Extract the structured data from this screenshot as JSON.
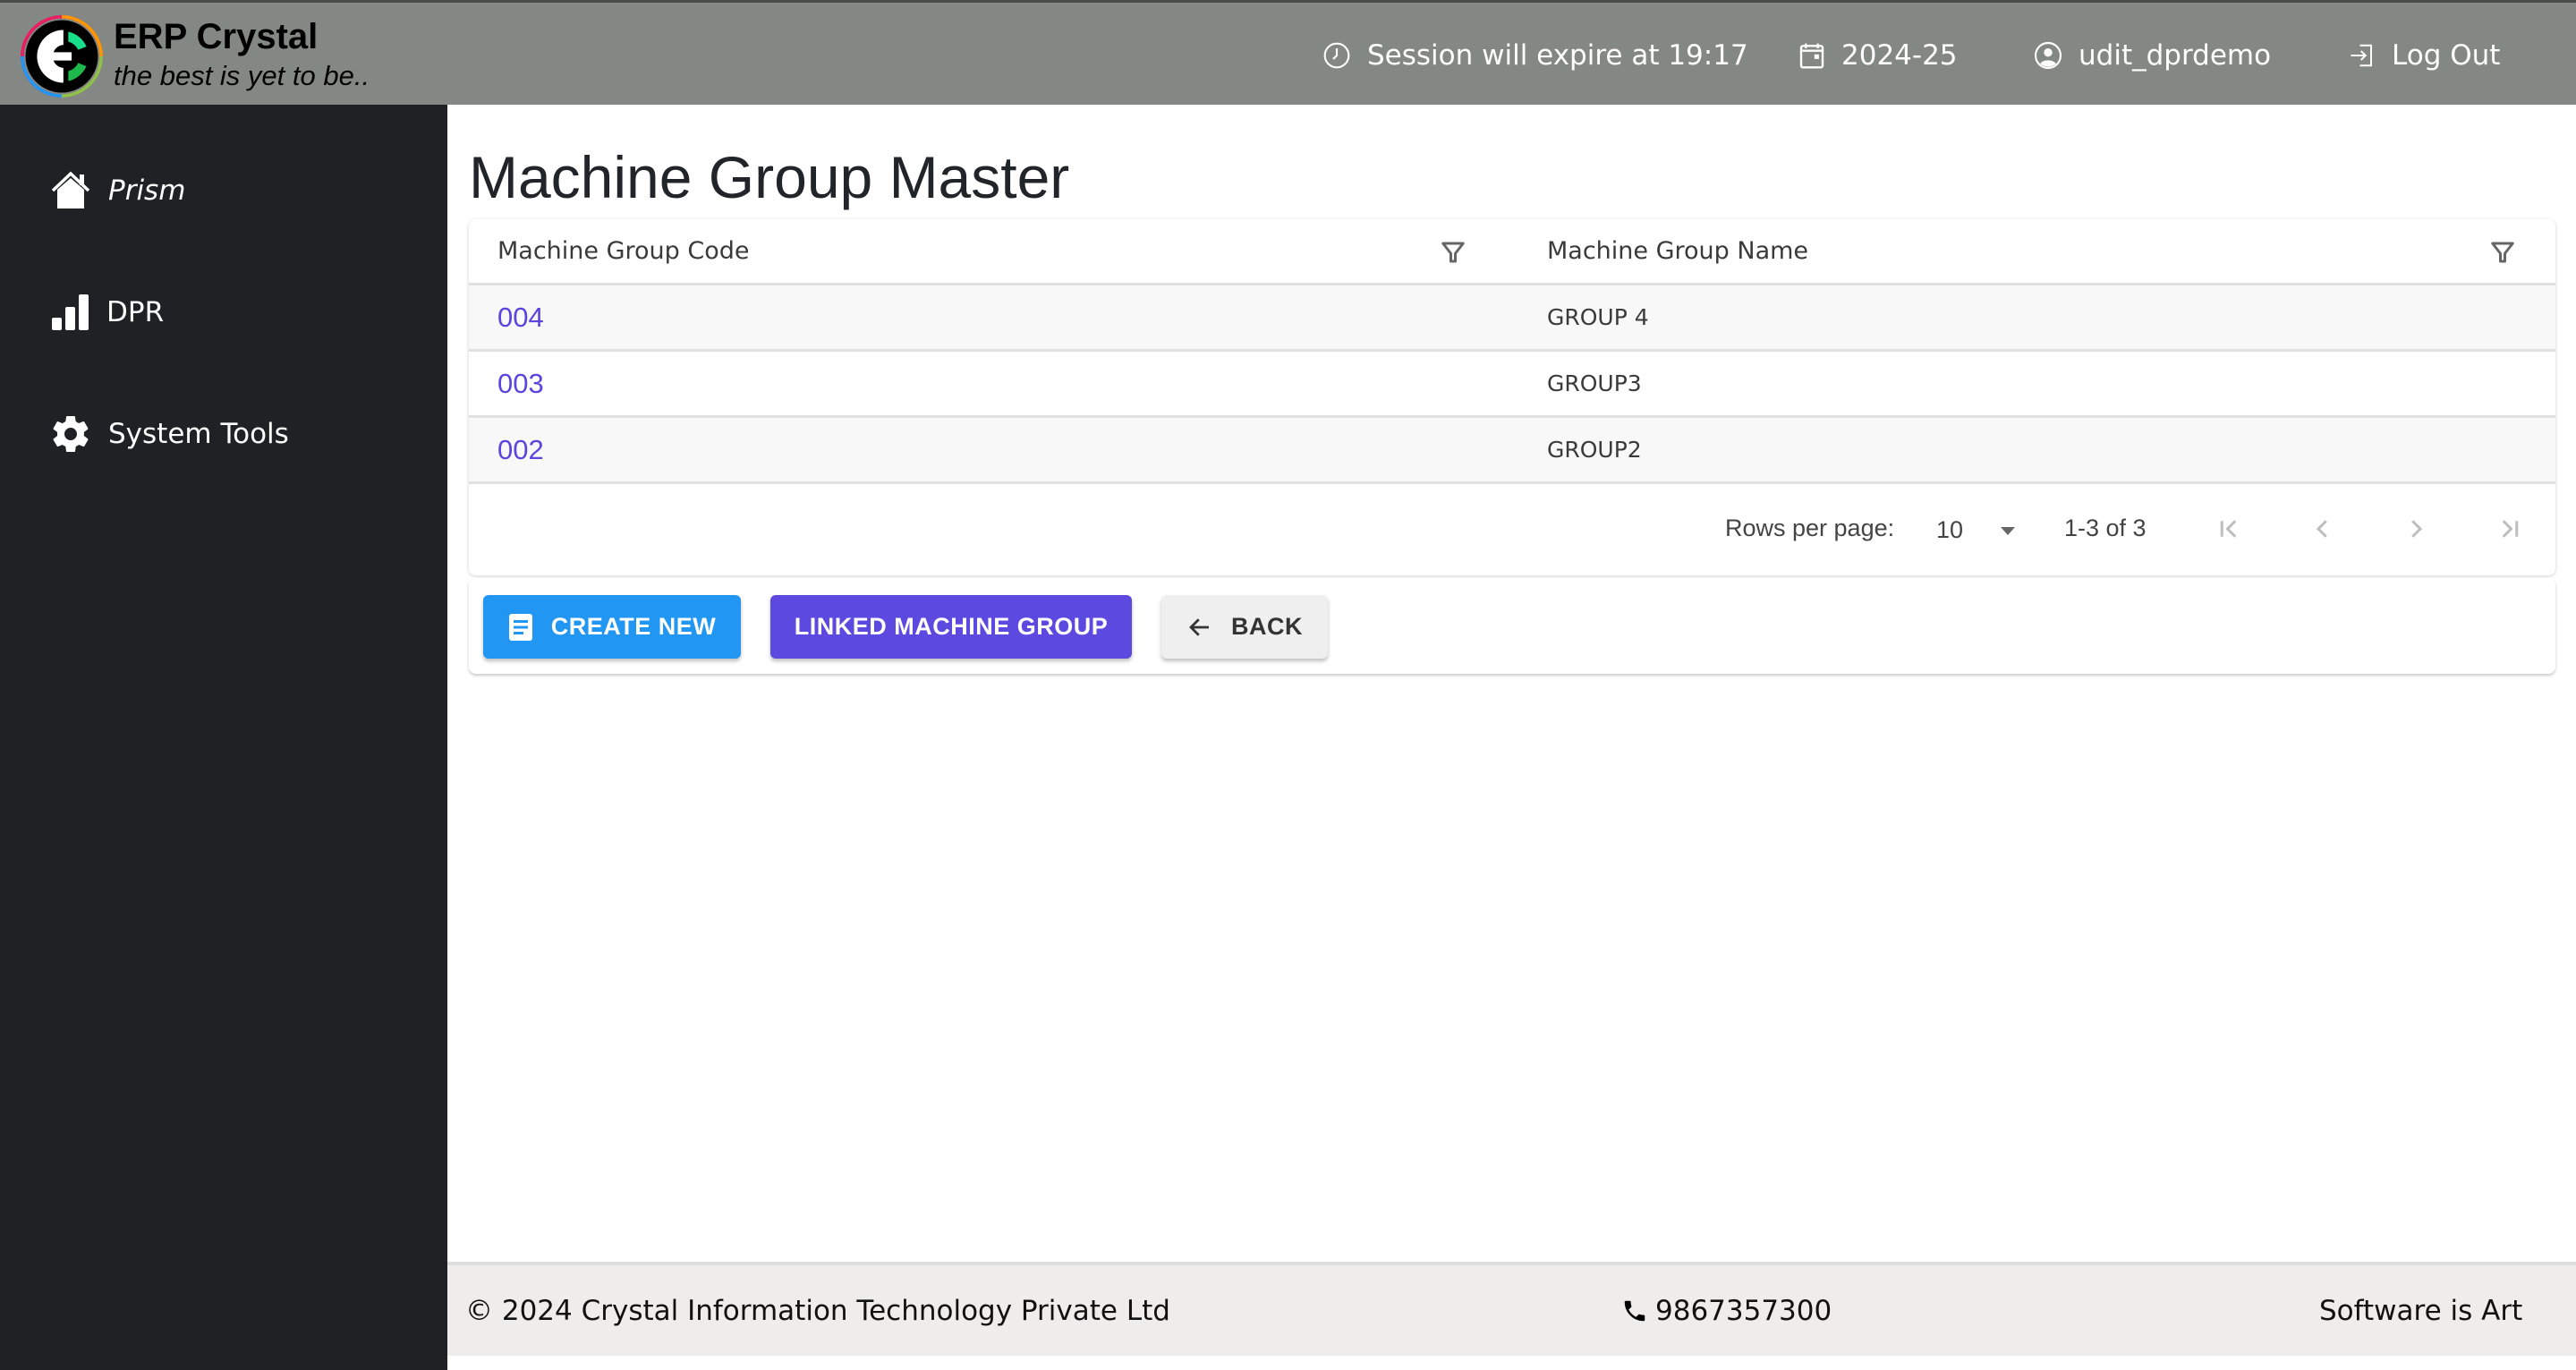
{
  "header": {
    "brand_title": "ERP Crystal",
    "brand_tagline": "the best is yet to be..",
    "session_text": "Session will expire at 19:17",
    "session_icon": "clock-icon",
    "financial_year": "2024-25",
    "financial_year_icon": "calendar-icon",
    "username": "udit_dprdemo",
    "user_icon": "user-circle-icon",
    "logout_label": "Log Out",
    "logout_icon": "logout-icon"
  },
  "sidebar": {
    "items": [
      {
        "label": "Prism",
        "icon": "home-icon"
      },
      {
        "label": "DPR",
        "icon": "bar-chart-icon"
      },
      {
        "label": "System Tools",
        "icon": "gear-icon"
      }
    ]
  },
  "page": {
    "title": "Machine Group Master"
  },
  "table": {
    "columns": [
      "Machine Group Code",
      "Machine Group Name"
    ],
    "rows": [
      {
        "code": "004",
        "name": "GROUP 4"
      },
      {
        "code": "003",
        "name": "GROUP3"
      },
      {
        "code": "002",
        "name": "GROUP2"
      }
    ],
    "pagination": {
      "rows_per_page_label": "Rows per page:",
      "rows_per_page_value": "10",
      "range_text": "1-3 of 3"
    }
  },
  "actions": {
    "create_new": "CREATE NEW",
    "linked_machine_group": "LINKED MACHINE GROUP",
    "back": "BACK"
  },
  "footer": {
    "copyright": "© 2024 Crystal Information Technology Private Ltd",
    "phone": "9867357300",
    "slogan": "Software is Art"
  },
  "colors": {
    "header_bg": "#848884",
    "sidebar_bg": "#202124",
    "link": "#5b45de",
    "create_button": "#2196f3",
    "linked_button": "#5b49e0",
    "footer_bg": "#efedec"
  }
}
